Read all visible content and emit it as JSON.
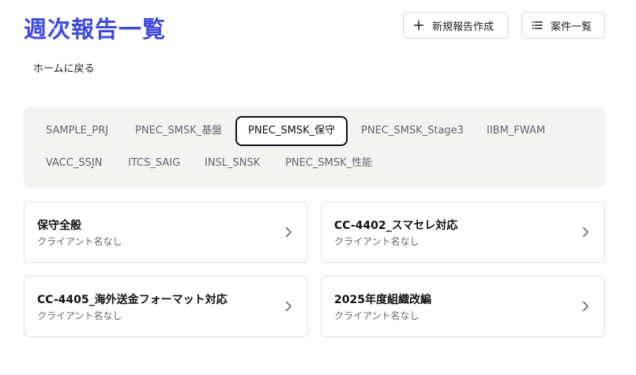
{
  "header": {
    "title": "週次報告一覧",
    "new_report_label": "新規報告作成",
    "new_report_icon": "plus-icon",
    "project_list_label": "案件一覧",
    "project_list_icon": "list-icon"
  },
  "nav": {
    "home_link": "ホームに戻る"
  },
  "project_tabs": {
    "selected": "PNEC_SMSK_保守",
    "items": [
      "SAMPLE_PRJ",
      "PNEC_SMSK_基盤",
      "PNEC_SMSK_保守",
      "PNEC_SMSK_Stage3",
      "IIBM_FWAM",
      "VACC_SSJN",
      "ITCS_SAIG",
      "INSL_SNSK",
      "PNEC_SMSK_性能"
    ]
  },
  "report_cards": [
    {
      "title": "保守全般",
      "client": "クライアント名なし"
    },
    {
      "title": "CC-4402_スマセレ対応",
      "client": "クライアント名なし"
    },
    {
      "title": "CC-4405_海外送金フォーマット対応",
      "client": "クライアント名なし"
    },
    {
      "title": "2025年度組織改編",
      "client": "クライアント名なし"
    }
  ],
  "colors": {
    "title": "#3f4ae0",
    "tab_panel_bg": "#f3f3f1",
    "active_tab_border": "#111111"
  }
}
